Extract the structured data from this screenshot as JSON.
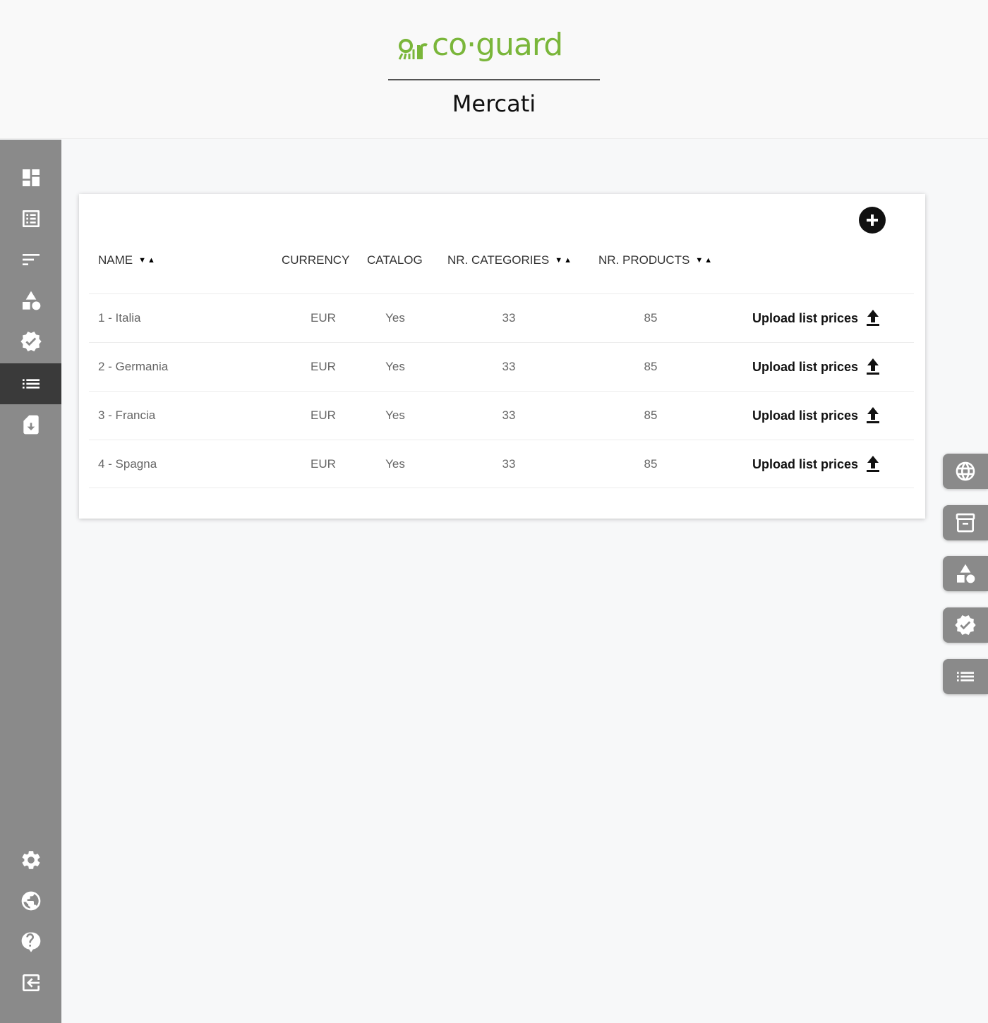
{
  "brand": {
    "logo_text": "co·guard",
    "accent": "#7ab63a"
  },
  "page": {
    "title": "Mercati"
  },
  "sidebar": {
    "items": [
      {
        "name": "dashboard-icon"
      },
      {
        "name": "list-alt-icon"
      },
      {
        "name": "sort-icon"
      },
      {
        "name": "shapes-icon"
      },
      {
        "name": "verified-badge-icon"
      },
      {
        "name": "markets-list-icon",
        "active": true
      },
      {
        "name": "download-file-icon"
      },
      {
        "name": "gear-icon"
      },
      {
        "name": "globe-people-icon"
      },
      {
        "name": "help-icon"
      },
      {
        "name": "logout-icon"
      }
    ]
  },
  "table": {
    "headers": {
      "name": "NAME",
      "currency": "CURRENCY",
      "catalog": "CATALOG",
      "categories": "NR. CATEGORIES",
      "products": "NR. PRODUCTS"
    },
    "sort_desc": "▼",
    "sort_asc": "▲",
    "upload_label": "Upload list prices",
    "rows": [
      {
        "name": "1 - Italia",
        "currency": "EUR",
        "catalog": "Yes",
        "categories": "33",
        "products": "85"
      },
      {
        "name": "2 - Germania",
        "currency": "EUR",
        "catalog": "Yes",
        "categories": "33",
        "products": "85"
      },
      {
        "name": "3 - Francia",
        "currency": "EUR",
        "catalog": "Yes",
        "categories": "33",
        "products": "85"
      },
      {
        "name": "4 - Spagna",
        "currency": "EUR",
        "catalog": "Yes",
        "categories": "33",
        "products": "85"
      }
    ]
  },
  "right_tabs": [
    {
      "name": "globe-icon"
    },
    {
      "name": "archive-icon"
    },
    {
      "name": "shapes-icon"
    },
    {
      "name": "verified-badge-icon"
    },
    {
      "name": "list-icon"
    }
  ]
}
